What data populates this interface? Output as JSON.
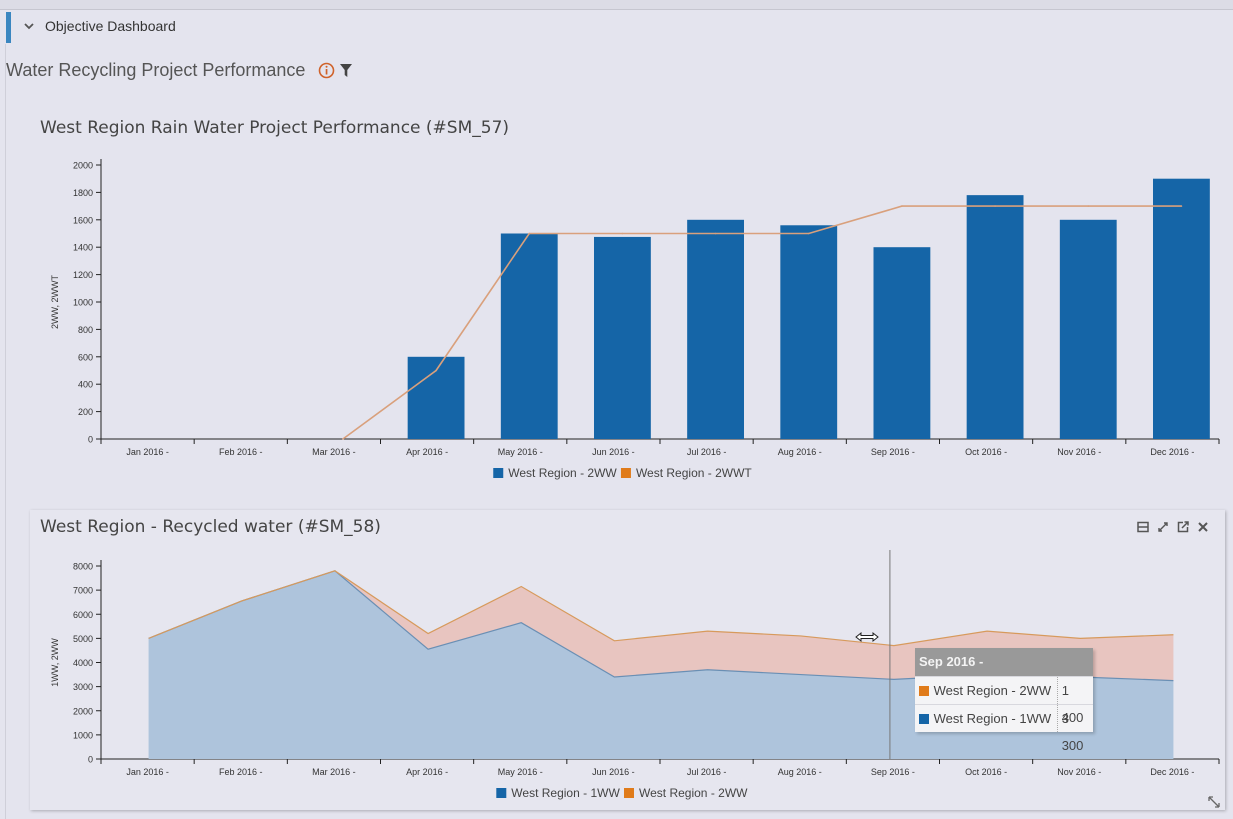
{
  "section": {
    "title": "Objective Dashboard"
  },
  "page": {
    "title": "Water Recycling Project Performance"
  },
  "colors": {
    "accent": "#3a86c0",
    "bar_blue": "#1565a7",
    "line_orange": "#e07b1a",
    "area_blue": "#aec4dc",
    "area_orange": "#e8c5c0"
  },
  "chart_data": [
    {
      "type": "bar",
      "title": "West Region Rain Water Project Performance (#SM_57)",
      "xlabel": "",
      "ylabel": "2WW, 2WWT",
      "ylim": [
        0,
        2000
      ],
      "yticks": [
        0,
        200,
        400,
        600,
        800,
        1000,
        1200,
        1400,
        1600,
        1800,
        2000
      ],
      "categories": [
        "Jan 2016 -",
        "Feb 2016 -",
        "Mar 2016 -",
        "Apr 2016 -",
        "May 2016 -",
        "Jun 2016 -",
        "Jul 2016 -",
        "Aug 2016 -",
        "Sep 2016 -",
        "Oct 2016 -",
        "Nov 2016 -",
        "Dec 2016 -"
      ],
      "series": [
        {
          "name": "West Region - 2WW",
          "kind": "bar",
          "color": "#1565a7",
          "values": [
            0,
            0,
            0,
            600,
            1500,
            1475,
            1600,
            1560,
            1400,
            1780,
            1600,
            1900
          ]
        },
        {
          "name": "West Region - 2WWT",
          "kind": "line",
          "color": "#e07b1a",
          "values": [
            null,
            null,
            0,
            500,
            1500,
            1500,
            1500,
            1500,
            1700,
            1700,
            1700,
            1700
          ]
        }
      ],
      "legend": "bottom",
      "grid": false
    },
    {
      "type": "area",
      "stacked": true,
      "title": "West Region - Recycled water (#SM_58)",
      "xlabel": "",
      "ylabel": "1WW, 2WW",
      "ylim": [
        0,
        8000
      ],
      "yticks": [
        0,
        1000,
        2000,
        3000,
        4000,
        5000,
        6000,
        7000,
        8000
      ],
      "categories": [
        "Jan 2016 -",
        "Feb 2016 -",
        "Mar 2016 -",
        "Apr 2016 -",
        "May 2016 -",
        "Jun 2016 -",
        "Jul 2016 -",
        "Aug 2016 -",
        "Sep 2016 -",
        "Oct 2016 -",
        "Nov 2016 -",
        "Dec 2016 -"
      ],
      "series": [
        {
          "name": "West Region - 1WW",
          "color": "#1565a7",
          "fill": "#aec4dc",
          "values": [
            5000,
            6550,
            7800,
            4550,
            5650,
            3400,
            3700,
            3500,
            3300,
            3500,
            3400,
            3250
          ]
        },
        {
          "name": "West Region - 2WW",
          "color": "#e07b1a",
          "fill": "#e8c5c0",
          "values": [
            0,
            0,
            0,
            650,
            1500,
            1500,
            1600,
            1600,
            1400,
            1800,
            1600,
            1900
          ]
        }
      ],
      "legend": "bottom",
      "grid": false,
      "hover_index": 8,
      "tooltip": {
        "title": "Sep 2016 -",
        "rows": [
          {
            "name": "West Region - 2WW",
            "color": "#e07b1a",
            "value": "1 400"
          },
          {
            "name": "West Region - 1WW",
            "color": "#1565a7",
            "value": "3 300"
          }
        ]
      }
    }
  ]
}
